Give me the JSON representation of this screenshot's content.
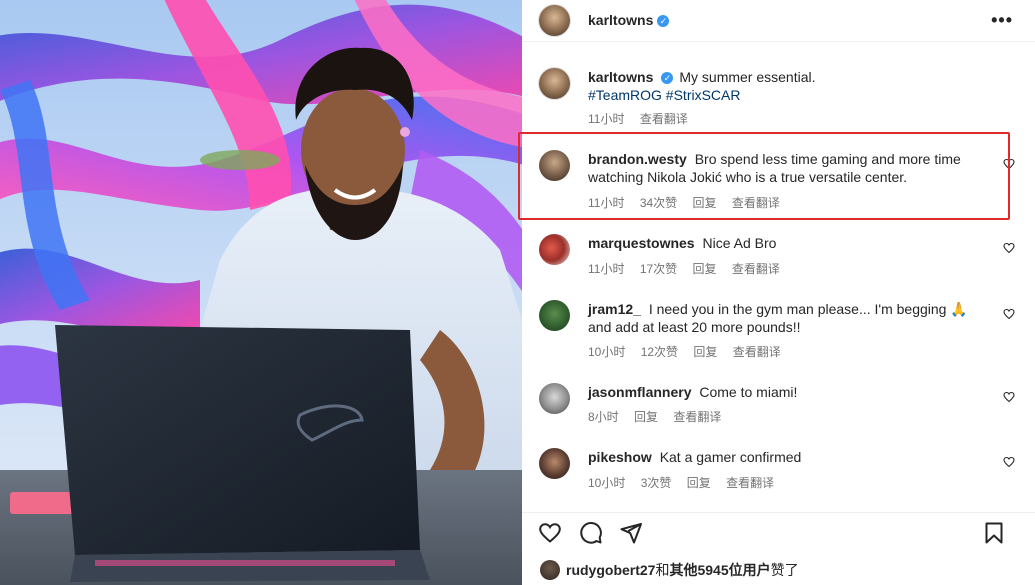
{
  "post": {
    "author": "karltowns",
    "verified_mark": "✓",
    "more_icon": "more-horizontal-icon",
    "caption": {
      "username": "karltowns",
      "text": "My summer essential.",
      "hashtags": "#TeamROG #StrixSCAR",
      "time": "11小时",
      "translate": "查看翻译"
    }
  },
  "comments": [
    {
      "username": "brandon.westy",
      "text": "Bro spend less time gaming and more time watching Nikola Jokić who is a true versatile center.",
      "time": "11小时",
      "likes": "34次赞",
      "reply": "回复",
      "translate": "查看翻译",
      "highlighted": true
    },
    {
      "username": "marquestownes",
      "text": "Nice Ad Bro",
      "time": "11小时",
      "likes": "17次赞",
      "reply": "回复",
      "translate": "查看翻译"
    },
    {
      "username": "jram12_",
      "text": "I need you in the gym man please... I'm begging 🙏 and add at least 20 more pounds!!",
      "time": "10小时",
      "likes": "12次赞",
      "reply": "回复",
      "translate": "查看翻译"
    },
    {
      "username": "jasonmflannery",
      "text": "Come to miami!",
      "time": "8小时",
      "reply": "回复",
      "translate": "查看翻译"
    },
    {
      "username": "pikeshow",
      "text": "Kat a gamer confirmed",
      "time": "10小时",
      "likes": "3次赞",
      "reply": "回复",
      "translate": "查看翻译"
    }
  ],
  "actions": {
    "like_icon": "heart-outline-icon",
    "comment_icon": "comment-bubble-icon",
    "share_icon": "send-paper-plane-icon",
    "save_icon": "bookmark-icon"
  },
  "liked_by": {
    "first_user": "rudygobert27",
    "connector": "和",
    "others": "其他5945位用户",
    "suffix": "赞了"
  },
  "colors": {
    "highlight_border": "#e0292b",
    "link": "#00376b",
    "meta_text": "#737373",
    "verified": "#3897f0"
  }
}
